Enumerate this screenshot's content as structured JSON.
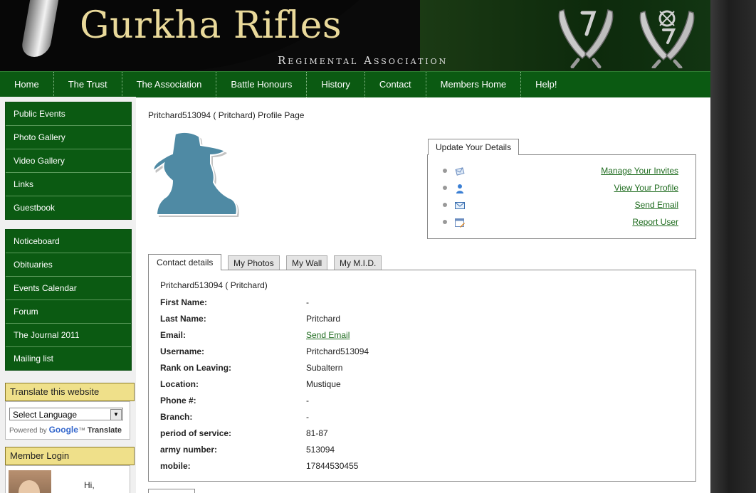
{
  "header": {
    "title": "Gurkha Rifles",
    "subtitle": "Regimental Association"
  },
  "nav": [
    "Home",
    "The Trust",
    "The Association",
    "Battle Honours",
    "History",
    "Contact",
    "Members Home",
    "Help!"
  ],
  "sidebar": {
    "menu1": [
      "Public Events",
      "Photo Gallery",
      "Video Gallery",
      "Links",
      "Guestbook"
    ],
    "menu2": [
      "Noticeboard",
      "Obituaries",
      "Events Calendar",
      "Forum",
      "The Journal 2011",
      "Mailing list"
    ],
    "translate": {
      "heading": "Translate this website",
      "select_value": "Select Language",
      "powered_by": "Powered by",
      "google": "Google",
      "tm": "™",
      "translate_word": "Translate"
    },
    "login": {
      "heading": "Member Login",
      "greeting": "Hi,"
    }
  },
  "profile": {
    "page_title": "Pritchard513094 ( Pritchard) Profile Page"
  },
  "update_box": {
    "tab_label": "Update Your Details",
    "links": [
      {
        "label": "Manage Your Invites",
        "icon": "invite-icon"
      },
      {
        "label": "View Your Profile",
        "icon": "user-icon"
      },
      {
        "label": "Send Email",
        "icon": "envelope-icon"
      },
      {
        "label": "Report User",
        "icon": "report-icon"
      }
    ]
  },
  "tabs": [
    "Contact details",
    "My Photos",
    "My Wall",
    "My M.I.D."
  ],
  "details": {
    "heading": "Pritchard513094 ( Pritchard)",
    "rows": [
      {
        "label": "First Name:",
        "value": "-"
      },
      {
        "label": "Last Name:",
        "value": "Pritchard"
      },
      {
        "label": "Email:",
        "value": "Send Email"
      },
      {
        "label": "Username:",
        "value": "Pritchard513094"
      },
      {
        "label": "Rank on Leaving:",
        "value": "Subaltern"
      },
      {
        "label": "Location:",
        "value": "Mustique"
      },
      {
        "label": "Phone #:",
        "value": "-"
      },
      {
        "label": "Branch:",
        "value": "-"
      },
      {
        "label": "period of service:",
        "value": "81-87"
      },
      {
        "label": "army number:",
        "value": "513094"
      },
      {
        "label": "mobile:",
        "value": "17844530455"
      }
    ]
  },
  "colors": {
    "nav_green": "#0b5a12",
    "link_green": "#1e6b1e",
    "title_gold": "#e9d99a",
    "box_yellow": "#efe08a"
  }
}
